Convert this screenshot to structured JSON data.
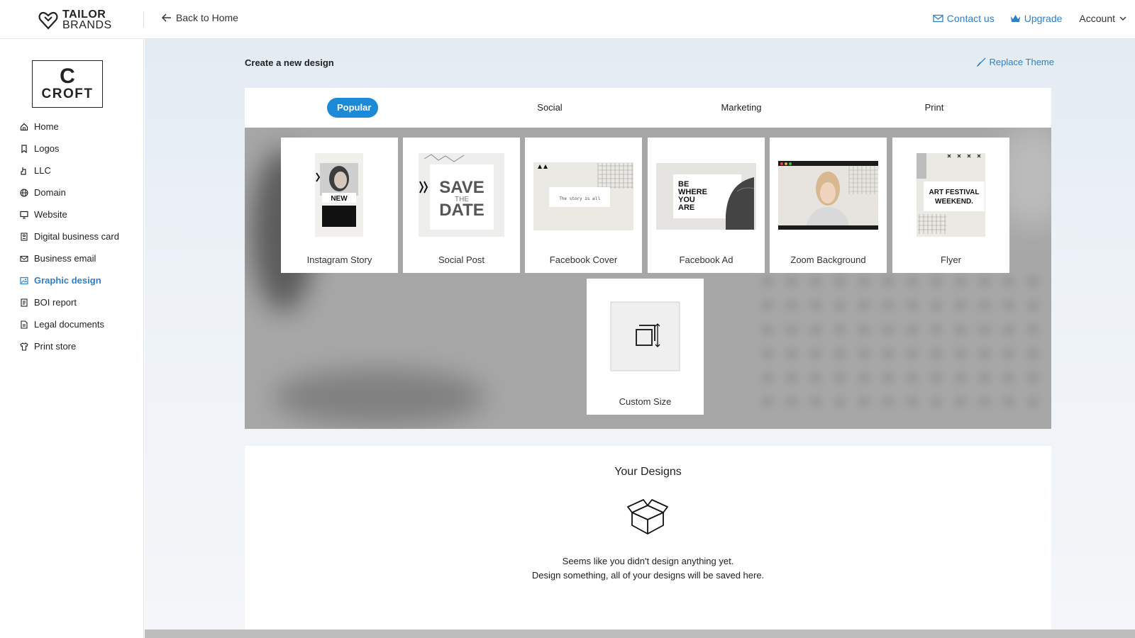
{
  "header": {
    "brand_line1": "TAILOR",
    "brand_line2": "BRANDS",
    "back_label": "Back to Home",
    "contact_label": "Contact us",
    "upgrade_label": "Upgrade",
    "account_label": "Account"
  },
  "sidebar": {
    "logo_letter": "C",
    "logo_word": "CROFT",
    "items": [
      {
        "label": "Home",
        "icon": "home-icon"
      },
      {
        "label": "Logos",
        "icon": "bookmark-icon"
      },
      {
        "label": "LLC",
        "icon": "hand-icon"
      },
      {
        "label": "Domain",
        "icon": "globe-icon"
      },
      {
        "label": "Website",
        "icon": "monitor-icon"
      },
      {
        "label": "Digital business card",
        "icon": "card-icon"
      },
      {
        "label": "Business email",
        "icon": "mail-icon"
      },
      {
        "label": "Graphic design",
        "icon": "image-icon",
        "active": true
      },
      {
        "label": "BOI report",
        "icon": "report-icon"
      },
      {
        "label": "Legal documents",
        "icon": "document-icon"
      },
      {
        "label": "Print store",
        "icon": "shirt-icon"
      }
    ]
  },
  "main": {
    "title": "Create a new design",
    "replace_theme_label": "Replace Theme",
    "tabs": [
      {
        "label": "Popular",
        "active": true
      },
      {
        "label": "Social"
      },
      {
        "label": "Marketing"
      },
      {
        "label": "Print"
      }
    ],
    "templates": [
      {
        "label": "Instagram Story",
        "thumb_text": "NEW"
      },
      {
        "label": "Social Post",
        "thumb_text_1": "SAVE",
        "thumb_text_2": "THE",
        "thumb_text_3": "DATE"
      },
      {
        "label": "Facebook Cover",
        "thumb_text": "The story is all"
      },
      {
        "label": "Facebook Ad",
        "thumb_text_1": "BE",
        "thumb_text_2": "WHERE",
        "thumb_text_3": "YOU",
        "thumb_text_4": "ARE"
      },
      {
        "label": "Zoom Background"
      },
      {
        "label": "Flyer",
        "thumb_text_1": "ART FESTIVAL",
        "thumb_text_2": "WEEKEND."
      },
      {
        "label": "Custom Size"
      }
    ]
  },
  "designs": {
    "title": "Your Designs",
    "message_line1": "Seems like you didn't design anything yet.",
    "message_line2": "Design something, all of your designs will be saved here."
  },
  "colors": {
    "accent": "#2f80c7",
    "tab_active": "#1c8ad6"
  }
}
